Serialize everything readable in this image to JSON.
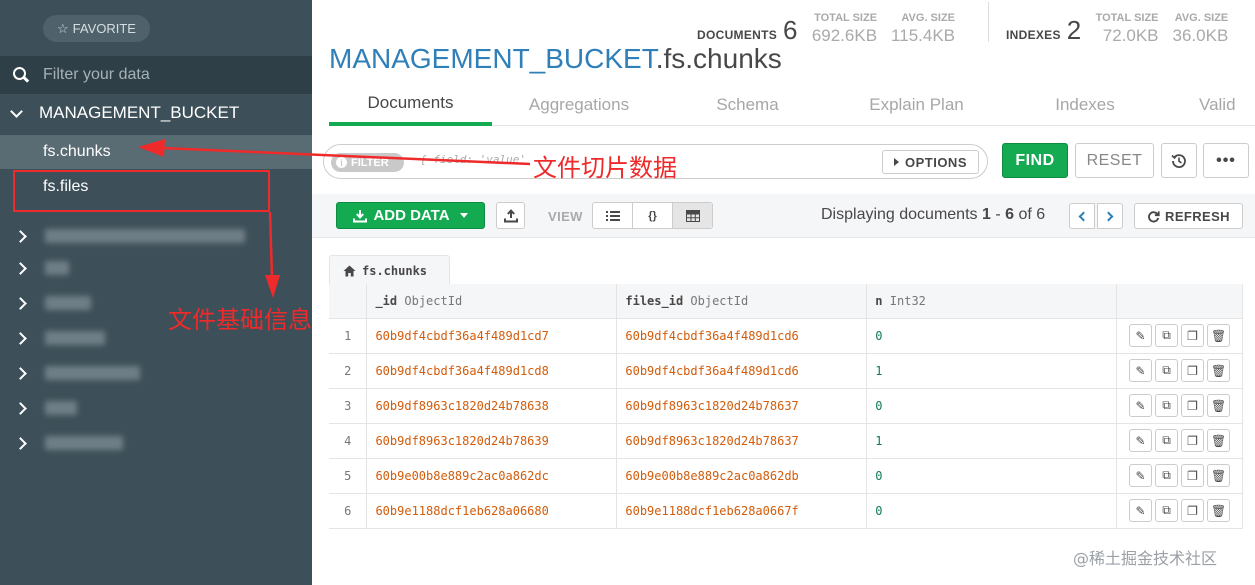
{
  "sidebar": {
    "favorite_label": "FAVORITE",
    "filter_placeholder": "Filter your data",
    "database": "MANAGEMENT_BUCKET",
    "collections": [
      {
        "label": "fs.chunks",
        "active": true
      },
      {
        "label": "fs.files",
        "active": false
      }
    ],
    "other_databases": [
      {
        "state": "collapsed"
      },
      {
        "state": "collapsed"
      },
      {
        "state": "collapsed"
      },
      {
        "state": "collapsed"
      },
      {
        "state": "collapsed"
      },
      {
        "state": "collapsed"
      },
      {
        "state": "collapsed"
      }
    ]
  },
  "stats": {
    "documents_label": "DOCUMENTS",
    "documents_count": "6",
    "total_size_label": "TOTAL SIZE",
    "total_size": "692.6KB",
    "avg_size_label": "AVG. SIZE",
    "avg_size": "115.4KB",
    "indexes_label": "INDEXES",
    "indexes_count": "2",
    "index_total_size_label": "TOTAL SIZE",
    "index_total_size": "72.0KB",
    "index_avg_size_label": "AVG. SIZE",
    "index_avg_size": "36.0KB"
  },
  "title": {
    "database": "MANAGEMENT_BUCKET",
    "collection": ".fs.chunks"
  },
  "tabs": [
    "Documents",
    "Aggregations",
    "Schema",
    "Explain Plan",
    "Indexes",
    "Valid"
  ],
  "query": {
    "filter_label": "FILTER",
    "placeholder": "{ field: 'value' }",
    "options_label": "OPTIONS",
    "find_label": "FIND",
    "reset_label": "RESET",
    "more_label": "•••"
  },
  "toolbar": {
    "add_data_label": "ADD DATA",
    "view_label": "VIEW",
    "view_json_label": "{}",
    "displaying_prefix": "Displaying documents ",
    "range_start": "1",
    "range_sep": " - ",
    "range_end": "6",
    "of_label": " of ",
    "total": "6",
    "refresh_label": "REFRESH"
  },
  "table": {
    "tab_label": "fs.chunks",
    "columns": [
      {
        "name": "_id",
        "type": "ObjectId"
      },
      {
        "name": "files_id",
        "type": "ObjectId"
      },
      {
        "name": "n",
        "type": "Int32"
      }
    ],
    "rows": [
      {
        "num": "1",
        "id": "60b9df4cbdf36a4f489d1cd7",
        "files_id": "60b9df4cbdf36a4f489d1cd6",
        "n": "0"
      },
      {
        "num": "2",
        "id": "60b9df4cbdf36a4f489d1cd8",
        "files_id": "60b9df4cbdf36a4f489d1cd6",
        "n": "1"
      },
      {
        "num": "3",
        "id": "60b9df8963c1820d24b78638",
        "files_id": "60b9df8963c1820d24b78637",
        "n": "0"
      },
      {
        "num": "4",
        "id": "60b9df8963c1820d24b78639",
        "files_id": "60b9df8963c1820d24b78637",
        "n": "1"
      },
      {
        "num": "5",
        "id": "60b9e00b8e889c2ac0a862dc",
        "files_id": "60b9e00b8e889c2ac0a862db",
        "n": "0"
      },
      {
        "num": "6",
        "id": "60b9e1188dcf1eb628a06680",
        "files_id": "60b9e1188dcf1eb628a0667f",
        "n": "0"
      }
    ]
  },
  "annotations": {
    "chunks_note": "文件切片数据",
    "files_note": "文件基础信息",
    "color": "#ee2a2a"
  },
  "watermark": "@稀土掘金技术社区",
  "colors": {
    "sidebar_bg": "#3d4f58",
    "accent_green": "#13aa52",
    "title_blue": "#2f7fb8",
    "objectid_orange": "#d25c0b",
    "number_green": "#107b56"
  }
}
